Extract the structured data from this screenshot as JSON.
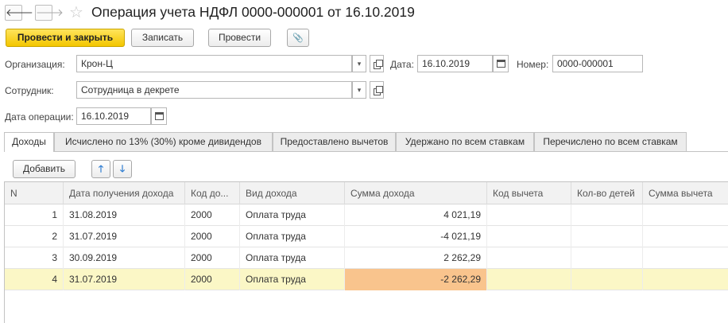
{
  "window": {
    "title": "Операция учета НДФЛ 0000-000001 от 16.10.2019",
    "back_glyph": "🡐",
    "forward_glyph": "🡒",
    "star_glyph": "☆"
  },
  "toolbar": {
    "post_close_label": "Провести и закрыть",
    "write_label": "Записать",
    "post_label": "Провести",
    "attach_glyph": "📎"
  },
  "form": {
    "organization_label": "Организация:",
    "organization_value": "Крон-Ц",
    "date_label": "Дата:",
    "date_value": "16.10.2019",
    "number_label": "Номер:",
    "number_value": "0000-000001",
    "employee_label": "Сотрудник:",
    "employee_value": "Сотрудница в декрете",
    "operation_date_label": "Дата операции:",
    "operation_date_value": "16.10.2019",
    "dropdown_glyph": "▾"
  },
  "tabs": [
    {
      "label": "Доходы",
      "active": true
    },
    {
      "label": "Исчислено по 13% (30%) кроме дивидендов",
      "active": false
    },
    {
      "label": "Предоставлено вычетов",
      "active": false
    },
    {
      "label": "Удержано по всем ставкам",
      "active": false
    },
    {
      "label": "Перечислено по всем ставкам",
      "active": false
    }
  ],
  "table_toolbar": {
    "add_label": "Добавить",
    "up_glyph": "🡑",
    "down_glyph": "🡓"
  },
  "table": {
    "columns": [
      "N",
      "Дата получения дохода",
      "Код до...",
      "Вид дохода",
      "Сумма дохода",
      "Код вычета",
      "Кол-во детей",
      "Сумма вычета"
    ],
    "rows": [
      {
        "n": "1",
        "date": "31.08.2019",
        "code": "2000",
        "type": "Оплата труда",
        "amount": "4 021,19",
        "deduction_code": "",
        "children": "",
        "deduction_amount": ""
      },
      {
        "n": "2",
        "date": "31.07.2019",
        "code": "2000",
        "type": "Оплата труда",
        "amount": "-4 021,19",
        "deduction_code": "",
        "children": "",
        "deduction_amount": ""
      },
      {
        "n": "3",
        "date": "30.09.2019",
        "code": "2000",
        "type": "Оплата труда",
        "amount": "2 262,29",
        "deduction_code": "",
        "children": "",
        "deduction_amount": ""
      },
      {
        "n": "4",
        "date": "31.07.2019",
        "code": "2000",
        "type": "Оплата труда",
        "amount": "-2 262,29",
        "deduction_code": "",
        "children": "",
        "deduction_amount": "",
        "selected": true
      }
    ]
  },
  "colors": {
    "primary_button": "#f3c600",
    "selected_row": "#fbf7c6",
    "selected_cell": "#f9c48d"
  }
}
